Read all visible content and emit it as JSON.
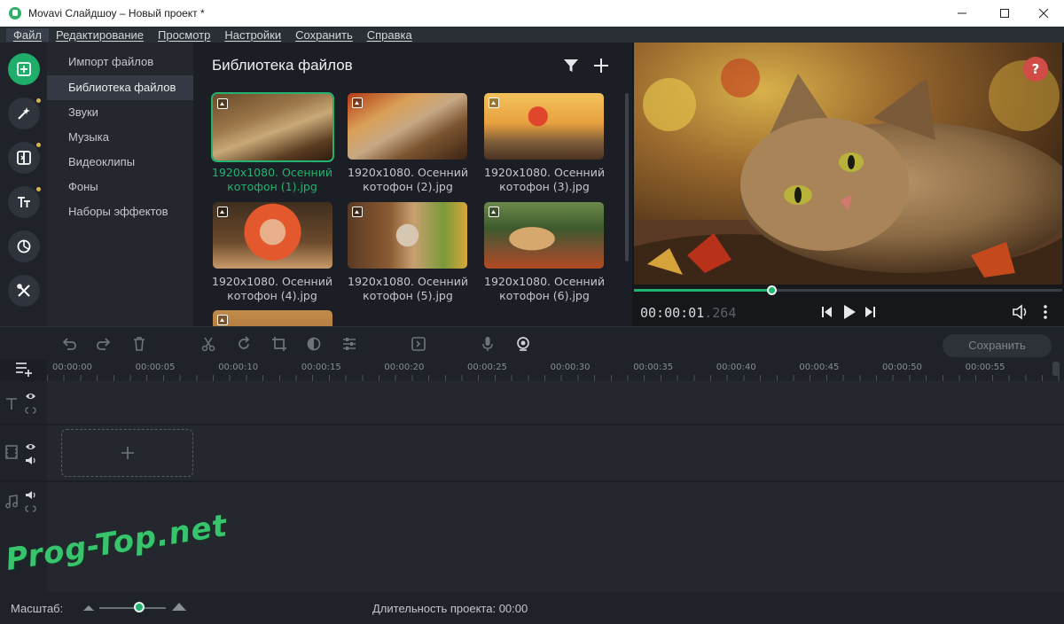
{
  "window": {
    "title": "Movavi Слайдшоу – Новый проект *"
  },
  "menu": [
    "Файл",
    "Редактирование",
    "Просмотр",
    "Настройки",
    "Сохранить",
    "Справка"
  ],
  "categories": [
    "Импорт файлов",
    "Библиотека файлов",
    "Звуки",
    "Музыка",
    "Видеоклипы",
    "Фоны",
    "Наборы эффектов"
  ],
  "active_category": 1,
  "library": {
    "title": "Библиотека файлов",
    "files": [
      {
        "line1": "1920x1080. Осенний",
        "line2": "котофон (1).jpg",
        "selected": true
      },
      {
        "line1": "1920x1080. Осенний",
        "line2": "котофон (2).jpg"
      },
      {
        "line1": "1920x1080. Осенний",
        "line2": "котофон (3).jpg"
      },
      {
        "line1": "1920x1080. Осенний",
        "line2": "котофон (4).jpg"
      },
      {
        "line1": "1920x1080. Осенний",
        "line2": "котофон (5).jpg"
      },
      {
        "line1": "1920x1080. Осенний",
        "line2": "котофон (6).jpg"
      }
    ]
  },
  "preview": {
    "help": "?",
    "timecode_main": "00:00:01",
    "timecode_ms": ".264",
    "progress": 0.32
  },
  "toolbar": {
    "save_label": "Сохранить"
  },
  "ruler": [
    "00:00:00",
    "00:00:05",
    "00:00:10",
    "00:00:15",
    "00:00:20",
    "00:00:25",
    "00:00:30",
    "00:00:35",
    "00:00:40",
    "00:00:45",
    "00:00:50",
    "00:00:55"
  ],
  "status": {
    "scale_label": "Масштаб:",
    "zoom_level": 0.6,
    "duration_label": "Длительность проекта:",
    "duration_value": "00:00"
  },
  "watermark": "Prog-Top.net",
  "colors": {
    "accent": "#21b36f",
    "help": "#d14c46",
    "tool_dot": "#d8b54a"
  }
}
